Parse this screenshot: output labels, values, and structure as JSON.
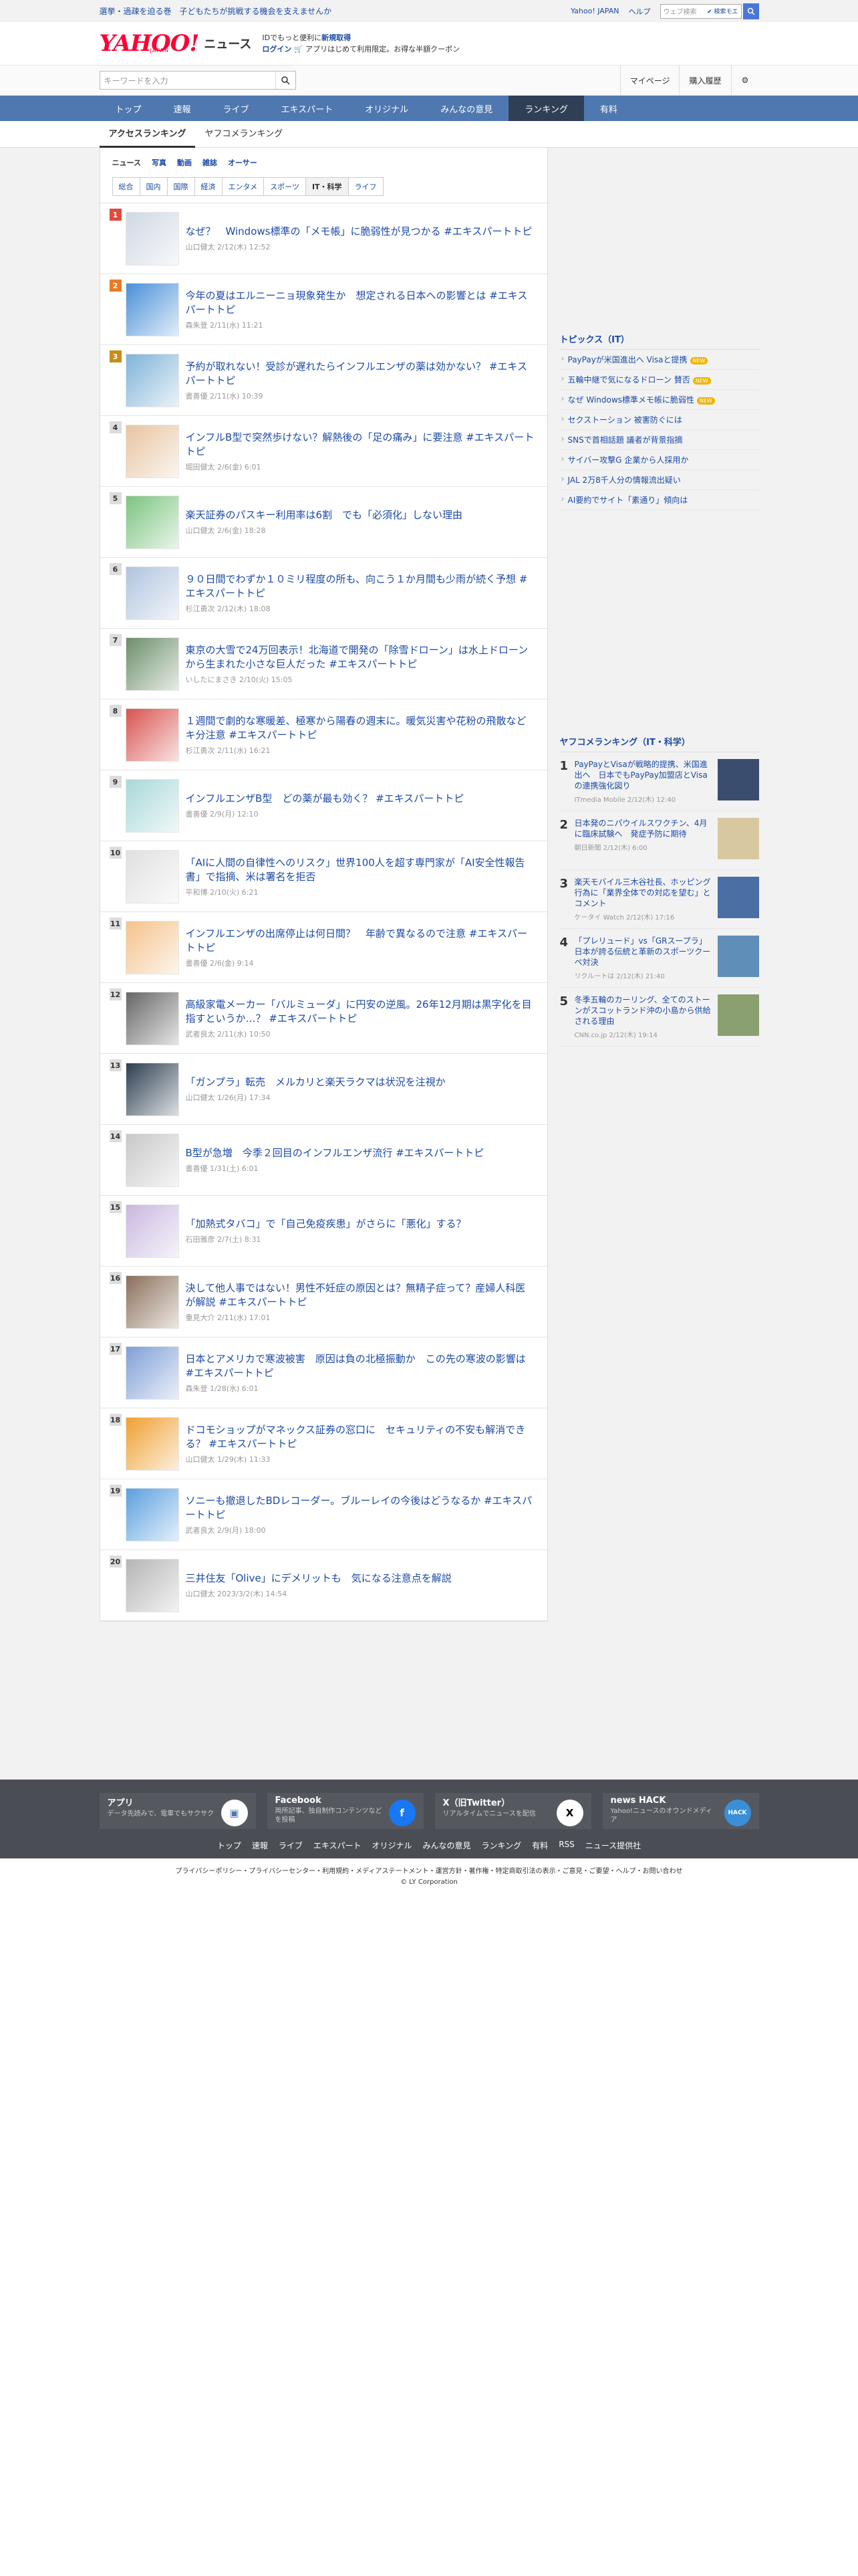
{
  "topbar": {
    "left_link": "選挙・過疎を迫る巻　子どもたちが挑戦する機会を支えませんか",
    "links": [
      "Yahoo! JAPAN",
      "ヘルプ"
    ],
    "search_placeholder": "ウェブ検索",
    "search_option": "✔ 検索モエ"
  },
  "header": {
    "logo": "YAHOO!",
    "logo_sub": "JAPAN",
    "logo_news": "ニュース",
    "promo_line1": "IDでもっと便利に",
    "promo_line1_bold": "新規取得",
    "promo_line2_login": "ログイン",
    "promo_line2": "アプリはじめて利用限定。お得な半額クーポン"
  },
  "search": {
    "placeholder": "キーワードを入力",
    "mypage": "マイページ",
    "history": "購入履歴"
  },
  "gnav": [
    "トップ",
    "速報",
    "ライブ",
    "エキスパート",
    "オリジナル",
    "みんなの意見",
    "ランキング",
    "有料"
  ],
  "subtabs": [
    "アクセスランキング",
    "ヤフコメランキング"
  ],
  "filters": [
    "ニュース",
    "写真",
    "動画",
    "雑誌",
    "オーサー"
  ],
  "cattabs": [
    "総合",
    "国内",
    "国際",
    "経済",
    "エンタメ",
    "スポーツ",
    "IT・科学",
    "ライフ"
  ],
  "articles": [
    {
      "rank": "1",
      "title": "なぜ？　Windows標準の「メモ帳」に脆弱性が見つかる #エキスパートトピ",
      "meta": "山口健太 2/12(木) 12:52"
    },
    {
      "rank": "2",
      "title": "今年の夏はエルニーニョ現象発生か　想定される日本への影響とは #エキスパートトピ",
      "meta": "森朱登 2/11(水) 11:21"
    },
    {
      "rank": "3",
      "title": "予約が取れない！受診が遅れたらインフルエンザの薬は効かない？ #エキスパートトピ",
      "meta": "書善優 2/11(水) 10:39"
    },
    {
      "rank": "4",
      "title": "インフルB型で突然歩けない？解熱後の「足の痛み」に要注意 #エキスパートトピ",
      "meta": "堀田健太 2/6(金) 6:01"
    },
    {
      "rank": "5",
      "title": "楽天証券のパスキー利用率は6割　でも「必須化」しない理由",
      "meta": "山口健太 2/6(金) 18:28"
    },
    {
      "rank": "6",
      "title": "９０日間でわずか１０ミリ程度の所も、向こう１か月間も少雨が続く予想 #エキスパートトピ",
      "meta": "杉江勇次 2/12(木) 18:08"
    },
    {
      "rank": "7",
      "title": "東京の大雪で24万回表示！北海道で開発の「除雪ドローン」は水上ドローンから生まれた小さな巨人だった #エキスパートトピ",
      "meta": "いしたにまさき 2/10(火) 15:05"
    },
    {
      "rank": "8",
      "title": "１週間で劇的な寒暖差、極寒から陽春の週末に。暖気災害や花粉の飛散などキ分注意 #エキスパートトピ",
      "meta": "杉江勇次 2/11(水) 16:21"
    },
    {
      "rank": "9",
      "title": "インフルエンザB型　どの薬が最も効く？ #エキスパートトピ",
      "meta": "書善優 2/9(月) 12:10"
    },
    {
      "rank": "10",
      "title": "「AIに人間の自律性へのリスク」世界100人を超す専門家が「AI安全性報告書」で指摘、米は署名を拒否",
      "meta": "平和博 2/10(火) 6:21"
    },
    {
      "rank": "11",
      "title": "インフルエンザの出席停止は何日間？　年齢で異なるので注意 #エキスパートトピ",
      "meta": "書善優 2/6(金) 9:14"
    },
    {
      "rank": "12",
      "title": "高級家電メーカー「バルミューダ」に円安の逆風。26年12月期は黒字化を目指すというか…？ #エキスパートトピ",
      "meta": "武者良太 2/11(水) 10:50"
    },
    {
      "rank": "13",
      "title": "「ガンプラ」転売　メルカリと楽天ラクマは状況を注視か",
      "meta": "山口健太 1/26(月) 17:34"
    },
    {
      "rank": "14",
      "title": "B型が急増　今季２回目のインフルエンザ流行 #エキスパートトピ",
      "meta": "書善優 1/31(土) 6:01"
    },
    {
      "rank": "15",
      "title": "「加熱式タバコ」で「自己免疫疾患」がさらに「悪化」する？",
      "meta": "石田雅彦 2/7(土) 8:31"
    },
    {
      "rank": "16",
      "title": "決して他人事ではない！男性不妊症の原因とは？無精子症って？産婦人科医が解説 #エキスパートトピ",
      "meta": "重見大介 2/11(水) 17:01"
    },
    {
      "rank": "17",
      "title": "日本とアメリカで寒波被害　原因は負の北極振動か　この先の寒波の影響は #エキスパートトピ",
      "meta": "森朱登 1/28(水) 6:01"
    },
    {
      "rank": "18",
      "title": "ドコモショップがマネックス証券の窓口に　セキュリティの不安も解消できる？ #エキスパートトピ",
      "meta": "山口健太 1/29(木) 11:33"
    },
    {
      "rank": "19",
      "title": "ソニーも撤退したBDレコーダー。ブルーレイの今後はどうなるか #エキスパートトピ",
      "meta": "武者良太 2/9(月) 18:00"
    },
    {
      "rank": "20",
      "title": "三井住友「Olive」にデメリットも　気になる注意点を解説",
      "meta": "山口健太 2023/3/2(木) 14:54"
    }
  ],
  "topics": {
    "heading": "トピックス（IT）",
    "new_label": "NEW",
    "items": [
      {
        "label": "PayPayが米国進出へ Visaと提携",
        "new": true
      },
      {
        "label": "五輪中継で気になるドローン 賛否",
        "new": true
      },
      {
        "label": "なぜ Windows標準メモ帳に脆弱性",
        "new": true
      },
      {
        "label": "セクストーション 被害防ぐには",
        "new": false
      },
      {
        "label": "SNSで首相話題 議者が背景指摘",
        "new": false
      },
      {
        "label": "サイバー攻撃G 企業から人採用か",
        "new": false
      },
      {
        "label": "JAL 2万8千人分の情報流出疑い",
        "new": false
      },
      {
        "label": "AI要約でサイト「素通り」傾向は",
        "new": false
      }
    ]
  },
  "yafucomi": {
    "heading": "ヤフコメランキング（IT・科学）",
    "items": [
      {
        "rank": "1",
        "title": "PayPayとVisaが戦略的提携、米国進出へ　日本でもPayPay加盟店とVisaの連携強化図り",
        "meta": "ITmedia Mobile 2/12(木) 12:40"
      },
      {
        "rank": "2",
        "title": "日本発のニパウイルスワクチン、4月に臨床試験へ　発症予防に期待",
        "meta": "朝日新聞 2/12(木) 6:00"
      },
      {
        "rank": "3",
        "title": "楽天モバイル三木谷社長、ホッピング行為に「業界全体での対応を望む」とコメント",
        "meta": "ケータイ Watch 2/12(木) 17:16"
      },
      {
        "rank": "4",
        "title": "「プレリュード」vs「GRスープラ」日本が誇る伝統と革新のスポーツクーペ対決",
        "meta": "リクルートは 2/12(木) 21:40"
      },
      {
        "rank": "5",
        "title": "冬季五輪のカーリング、全てのストーンがスコットランド沖の小島から供給される理由",
        "meta": "CNN.co.jp 2/12(木) 19:14"
      }
    ]
  },
  "footer": {
    "apps": [
      {
        "name": "アプリ",
        "desc": "データ先読みで、電車でもサクサク"
      },
      {
        "name": "Facebook",
        "desc": "両所記事、独自制作コンテンツなどを投稿"
      },
      {
        "name": "X（旧Twitter）",
        "desc": "リアルタイムでニュースを配信"
      },
      {
        "name": "news HACK",
        "desc": "Yahoo!ニュースのオウンドメディア"
      }
    ],
    "nav": [
      "トップ",
      "速報",
      "ライブ",
      "エキスパート",
      "オリジナル",
      "みんなの意見",
      "ランキング",
      "有料",
      "RSS",
      "ニュース提供社"
    ],
    "legal": "プライバシーポリシー・プライバシーセンター・利用規約・メディアステートメント・運営方針・著作権・特定商取引法の表示・ご意見・ご要望・ヘルプ・お問い合わせ",
    "copyright": "© LY Corporation"
  },
  "colors": {
    "accent": "#1c4aa6",
    "nav": "#4f78b1",
    "brand": "#ff0033"
  }
}
